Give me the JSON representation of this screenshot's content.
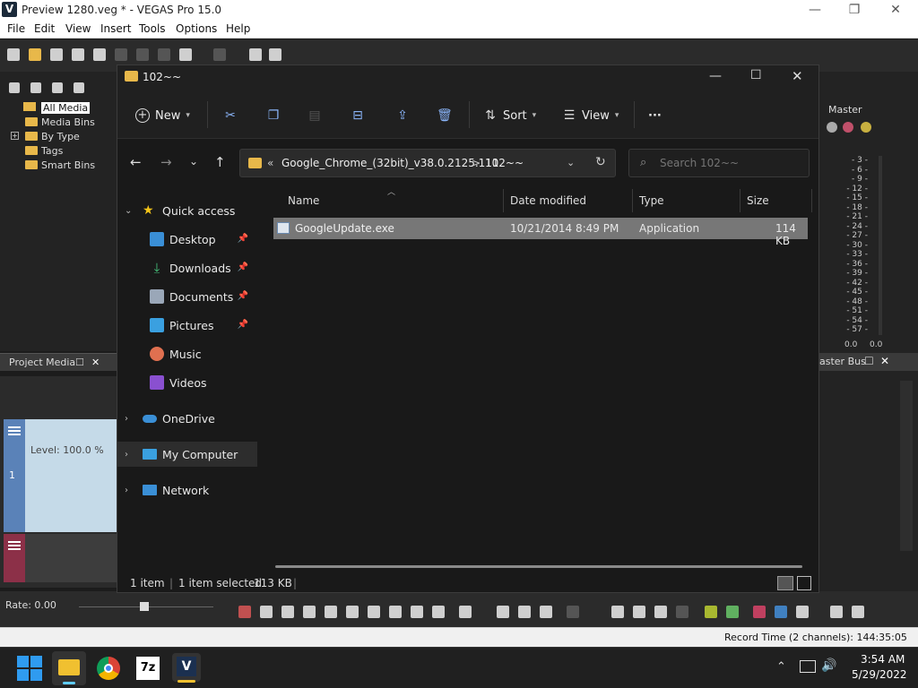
{
  "vegas": {
    "title": "Preview 1280.veg * - VEGAS Pro 15.0",
    "logo": "V",
    "menu": [
      "File",
      "Edit",
      "View",
      "Insert",
      "Tools",
      "Options",
      "Help"
    ],
    "media_tree": {
      "all_media": "All Media",
      "media_bins": "Media Bins",
      "by_type": "By Type",
      "tags": "Tags",
      "smart_bins": "Smart Bins"
    },
    "project_media_tab": "Project Media",
    "track_level": "Level: 100.0 %",
    "track_number": "1",
    "rate": "Rate: 0.00",
    "record_time": "Record Time (2 channels): 144:35:05",
    "master_label": "Master",
    "master_bus_label": "aster Bus",
    "meter_scale": [
      "3",
      "6",
      "9",
      "12",
      "15",
      "18",
      "21",
      "24",
      "27",
      "30",
      "33",
      "36",
      "39",
      "42",
      "45",
      "48",
      "51",
      "54",
      "57"
    ],
    "meter_values": [
      "0.0",
      "0.0"
    ]
  },
  "explorer": {
    "title": "102~~",
    "toolbar": {
      "new_label": "New",
      "sort_label": "Sort",
      "view_label": "View",
      "more_label": "···"
    },
    "address": {
      "overflow": "«",
      "crumb1": "Google_Chrome_(32bit)_v38.0.2125.111",
      "sep": ">",
      "crumb2": "102~~",
      "search_placeholder": "Search 102~~"
    },
    "nav": {
      "quick_access": "Quick access",
      "desktop": "Desktop",
      "downloads": "Downloads",
      "documents": "Documents",
      "pictures": "Pictures",
      "music": "Music",
      "videos": "Videos",
      "onedrive": "OneDrive",
      "my_computer": "My Computer",
      "network": "Network"
    },
    "columns": {
      "name": "Name",
      "date": "Date modified",
      "type": "Type",
      "size": "Size"
    },
    "file": {
      "name": "GoogleUpdate.exe",
      "date": "10/21/2014 8:49 PM",
      "type": "Application",
      "size": "114 KB"
    },
    "status": {
      "count": "1 item",
      "selected": "1 item selected",
      "sel_size": "113 KB"
    }
  },
  "taskbar": {
    "time": "3:54 AM",
    "date": "5/29/2022",
    "sevenzip": "7z",
    "vegas": "V"
  },
  "colors": {
    "accent": "#60cdff",
    "folder": "#e8b84a",
    "selection": "#777777"
  }
}
